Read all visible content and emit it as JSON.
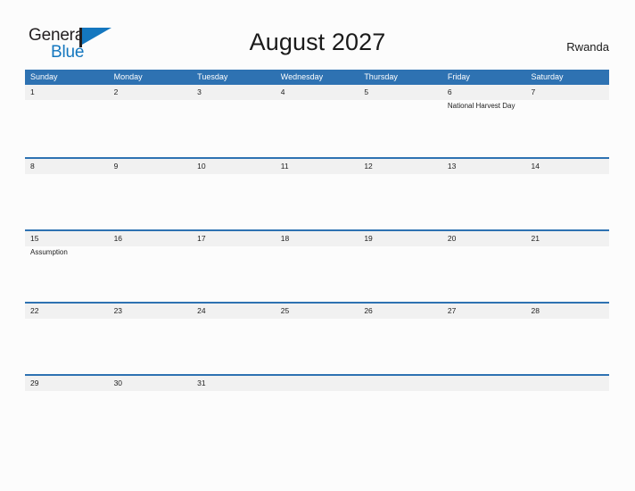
{
  "brand": {
    "name_part1": "General",
    "name_part2": "Blue",
    "flag_color": "#1477bf",
    "pole_color": "#231f20"
  },
  "header": {
    "title": "August 2027",
    "country": "Rwanda"
  },
  "theme": {
    "header_blue": "#2e72b2",
    "band_gray": "#f1f1f1",
    "page_background": "#fcfcfc",
    "text_color": "#222222"
  },
  "calendar": {
    "month": "August",
    "year": "2027",
    "weekdays": [
      "Sunday",
      "Monday",
      "Tuesday",
      "Wednesday",
      "Thursday",
      "Friday",
      "Saturday"
    ],
    "weeks": [
      {
        "days": [
          {
            "num": "1",
            "events": []
          },
          {
            "num": "2",
            "events": []
          },
          {
            "num": "3",
            "events": []
          },
          {
            "num": "4",
            "events": []
          },
          {
            "num": "5",
            "events": []
          },
          {
            "num": "6",
            "events": [
              "National Harvest Day"
            ]
          },
          {
            "num": "7",
            "events": []
          }
        ]
      },
      {
        "days": [
          {
            "num": "8",
            "events": []
          },
          {
            "num": "9",
            "events": []
          },
          {
            "num": "10",
            "events": []
          },
          {
            "num": "11",
            "events": []
          },
          {
            "num": "12",
            "events": []
          },
          {
            "num": "13",
            "events": []
          },
          {
            "num": "14",
            "events": []
          }
        ]
      },
      {
        "days": [
          {
            "num": "15",
            "events": [
              "Assumption"
            ]
          },
          {
            "num": "16",
            "events": []
          },
          {
            "num": "17",
            "events": []
          },
          {
            "num": "18",
            "events": []
          },
          {
            "num": "19",
            "events": []
          },
          {
            "num": "20",
            "events": []
          },
          {
            "num": "21",
            "events": []
          }
        ]
      },
      {
        "days": [
          {
            "num": "22",
            "events": []
          },
          {
            "num": "23",
            "events": []
          },
          {
            "num": "24",
            "events": []
          },
          {
            "num": "25",
            "events": []
          },
          {
            "num": "26",
            "events": []
          },
          {
            "num": "27",
            "events": []
          },
          {
            "num": "28",
            "events": []
          }
        ]
      },
      {
        "days": [
          {
            "num": "29",
            "events": []
          },
          {
            "num": "30",
            "events": []
          },
          {
            "num": "31",
            "events": []
          },
          {
            "num": "",
            "events": []
          },
          {
            "num": "",
            "events": []
          },
          {
            "num": "",
            "events": []
          },
          {
            "num": "",
            "events": []
          }
        ]
      }
    ]
  }
}
